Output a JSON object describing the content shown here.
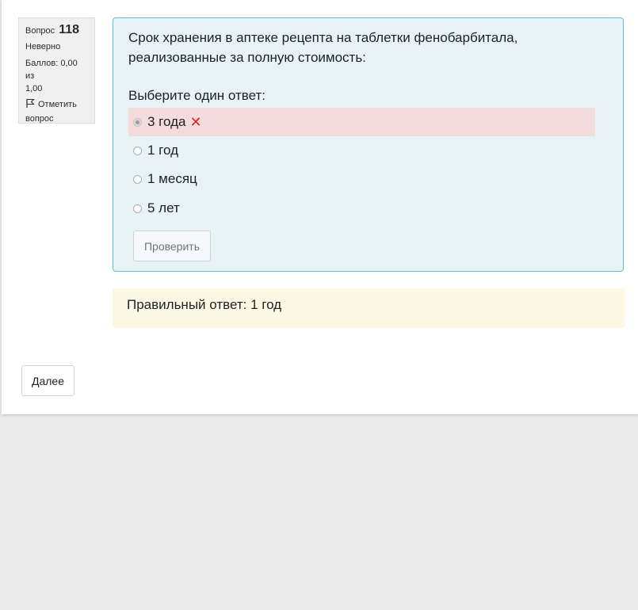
{
  "question_info": {
    "label": "Вопрос",
    "number": "118",
    "state": "Неверно",
    "grade_line1": "Баллов: 0,00 из",
    "grade_line2": "1,00",
    "flag_line1": "Отметить",
    "flag_line2": "вопрос"
  },
  "question": {
    "text_line1": "Срок хранения в аптеке рецепта на таблетки фенобарбитала,",
    "text_line2": "реализованные за полную стоимость:",
    "prompt": "Выберите один ответ:",
    "answers": [
      {
        "label": "3 года",
        "selected": true,
        "incorrect": true
      },
      {
        "label": "1 год",
        "selected": false
      },
      {
        "label": "1 месяц",
        "selected": false
      },
      {
        "label": "5 лет",
        "selected": false
      }
    ],
    "check_label": "Проверить"
  },
  "feedback": {
    "right_answer": "Правильный ответ: 1 год"
  },
  "navigation": {
    "next_label": "Далее"
  },
  "colors": {
    "info_border": "#5bc0de",
    "incorrect_bg": "#f4dcdc",
    "outcome_bg": "#fcf8e3",
    "incorrect_mark": "#e02424"
  }
}
